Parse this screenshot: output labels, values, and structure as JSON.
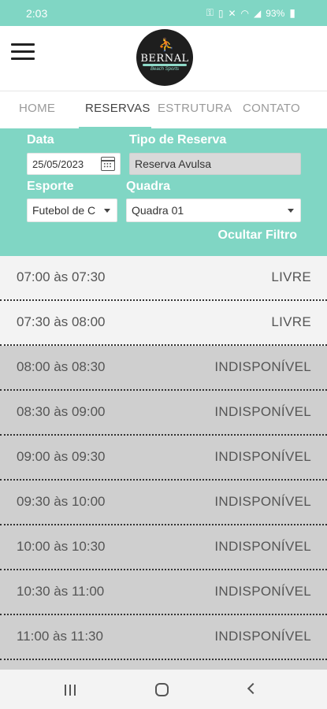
{
  "status_bar": {
    "time": "2:03",
    "icons": [
      "key-icon",
      "battery-saver-icon",
      "mute-icon",
      "wifi-icon",
      "signal-icon",
      "battery-icon"
    ],
    "battery": "93%"
  },
  "header": {
    "logo_text": "BERNAL",
    "logo_subtext": "Beach Sports"
  },
  "tabs": [
    {
      "label": "HOME",
      "active": false
    },
    {
      "label": "RESERVAS",
      "active": true
    },
    {
      "label": "ESTRUTURA",
      "active": false
    },
    {
      "label": "CONTATO",
      "active": false
    }
  ],
  "filter": {
    "date_label": "Data",
    "date_value": "25/05/2023",
    "type_label": "Tipo de Reserva",
    "type_value": "Reserva Avulsa",
    "sport_label": "Esporte",
    "sport_value": "Futebol de C",
    "court_label": "Quadra",
    "court_value": "Quadra 01",
    "toggle_label": "Ocultar Filtro"
  },
  "slots": [
    {
      "time": "07:00 às 07:30",
      "status": "LIVRE"
    },
    {
      "time": "07:30 às 08:00",
      "status": "LIVRE"
    },
    {
      "time": "08:00 às 08:30",
      "status": "INDISPONÍVEL"
    },
    {
      "time": "08:30 às 09:00",
      "status": "INDISPONÍVEL"
    },
    {
      "time": "09:00 às 09:30",
      "status": "INDISPONÍVEL"
    },
    {
      "time": "09:30 às 10:00",
      "status": "INDISPONÍVEL"
    },
    {
      "time": "10:00 às 10:30",
      "status": "INDISPONÍVEL"
    },
    {
      "time": "10:30 às 11:00",
      "status": "INDISPONÍVEL"
    },
    {
      "time": "11:00 às 11:30",
      "status": "INDISPONÍVEL"
    },
    {
      "time": "",
      "status": ""
    }
  ],
  "colors": {
    "accent": "#80d6c4",
    "free_row": "#f3f3f3",
    "unavailable_row": "#cfcfcf"
  }
}
